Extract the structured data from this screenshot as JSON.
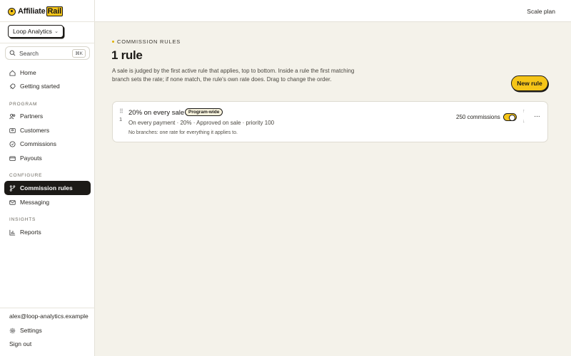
{
  "brand": {
    "name_part1": "Affiliate",
    "name_part2": "Rail",
    "accent_color": "#f5c518"
  },
  "workspace": {
    "label": "Loop Analytics"
  },
  "search": {
    "placeholder": "Search",
    "shortcut": "⌘K"
  },
  "nav": {
    "home": "Home",
    "getting_started": "Getting started",
    "program_label": "PROGRAM",
    "partners": "Partners",
    "customers": "Customers",
    "commissions": "Commissions",
    "payouts": "Payouts",
    "configure_label": "CONFIGURE",
    "commission_rules": "Commission rules",
    "messaging": "Messaging",
    "insights_label": "INSIGHTS",
    "reports": "Reports"
  },
  "footer": {
    "email": "alex@loop-analytics.example",
    "settings": "Settings",
    "sign_out": "Sign out"
  },
  "topbar": {
    "plan": "Scale plan"
  },
  "main": {
    "eyebrow": "COMMISSION RULES",
    "title": "1 rule",
    "description": "A sale is judged by the first active rule that applies, top to bottom. Inside a rule the first matching branch sets the rate; if none match, the rule's own rate does. Drag to change the order.",
    "new_rule_label": "New rule"
  },
  "rules": [
    {
      "index": "1",
      "name": "20% on every sale",
      "badge": "Program-wide",
      "meta": "On every payment · 20% · Approved on sale · priority 100",
      "note": "No branches: one rate for everything it applies to.",
      "commissions": "250 commissions",
      "enabled": true
    }
  ]
}
